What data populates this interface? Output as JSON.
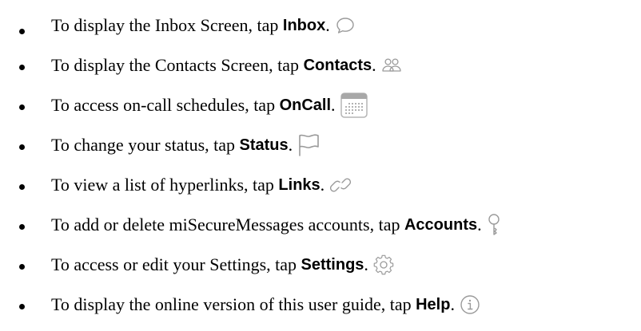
{
  "items": [
    {
      "prefix": "To display the Inbox Screen, tap ",
      "keyword": "Inbox",
      "suffix": ".",
      "icon": "chat-bubble-icon"
    },
    {
      "prefix": "To display the Contacts Screen, tap ",
      "keyword": "Contacts",
      "suffix": ".",
      "icon": "contacts-icon"
    },
    {
      "prefix": "To access on-call schedules, tap ",
      "keyword": "OnCall",
      "suffix": ".",
      "icon": "calendar-icon"
    },
    {
      "prefix": "To change your status, tap ",
      "keyword": "Status",
      "suffix": ".",
      "icon": "flag-icon"
    },
    {
      "prefix": "To view a list of hyperlinks, tap ",
      "keyword": "Links",
      "suffix": ".",
      "icon": "link-icon"
    },
    {
      "prefix": "To add or delete miSecureMessages accounts, tap ",
      "keyword": "Accounts",
      "suffix": ".",
      "icon": "key-icon"
    },
    {
      "prefix": "To access or edit your Settings, tap ",
      "keyword": "Settings",
      "suffix": ".",
      "icon": "gear-icon"
    },
    {
      "prefix": "To display the online version of this user guide, tap ",
      "keyword": "Help",
      "suffix": ".",
      "icon": "info-icon"
    }
  ],
  "colors": {
    "text": "#000000",
    "icon_stroke": "#9a9a9a"
  }
}
